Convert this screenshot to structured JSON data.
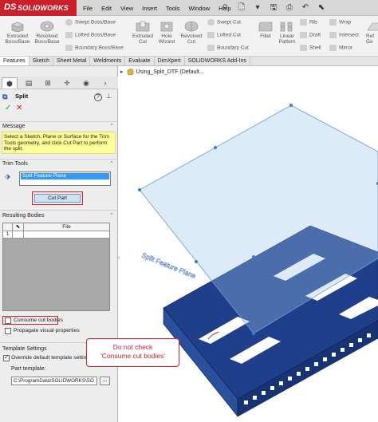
{
  "app": {
    "logo_ds": "DS",
    "logo_text": "SOLIDWORKS"
  },
  "menu": [
    "File",
    "Edit",
    "View",
    "Insert",
    "Tools",
    "Window",
    "Help"
  ],
  "toolbar": {
    "extruded_boss": "Extruded Boss/Base",
    "revolved_boss": "Revolved Boss/Base",
    "swept_boss": "Swept Boss/Base",
    "lofted_boss": "Lofted Boss/Base",
    "boundary_boss": "Boundary Boss/Base",
    "extruded_cut": "Extruded Cut",
    "hole_wizard": "Hole Wizard",
    "revolved_cut": "Revolved Cut",
    "swept_cut": "Swept Cut",
    "lofted_cut": "Lofted Cut",
    "boundary_cut": "Boundary Cut",
    "fillet": "Fillet",
    "linear_pattern": "Linear Pattern",
    "rib": "Rib",
    "draft": "Draft",
    "shell": "Shell",
    "wrap": "Wrap",
    "intersect": "Intersect",
    "mirror": "Mirror",
    "ref_geo": "Ref Ge"
  },
  "tabs": [
    "Features",
    "Sketch",
    "Sheet Metal",
    "Weldments",
    "Evaluate",
    "DimXpert",
    "SOLIDWORKS Add-Ins"
  ],
  "property_manager": {
    "title": "Split",
    "ok": "✓",
    "cancel": "✕",
    "help": "?",
    "message_title": "Message",
    "message": "Select a Sketch, Plane or Surface for the Trim Tools geometry, and click Cut Part to perform the split.",
    "trim_title": "Trim Tools",
    "trim_item": "Split Feature Plane",
    "cut_part": "Cut Part",
    "bodies_title": "Resulting Bodies",
    "table_header_file": "File",
    "row1_index": "1",
    "consume": "Consume cut bodies",
    "propagate": "Propagate visual properties",
    "template_title": "Template Settings",
    "override": "Override default template settings",
    "part_template_label": "Part template:",
    "part_template_value": "C:\\ProgramData\\SOLIDWORKS\\SO",
    "browse": "..."
  },
  "tree": {
    "root": "Using_Split_DTF  (Default..."
  },
  "viewport": {
    "plane_label": "Split Feature Plane"
  },
  "callout": {
    "line1": "Do not check",
    "line2": "'Consume cut bodies'"
  },
  "colors": {
    "brand": "#c9202a",
    "part_blue": "#1f3f8a",
    "highlight_red": "#d81e26",
    "message_yellow": "#ffff99"
  }
}
